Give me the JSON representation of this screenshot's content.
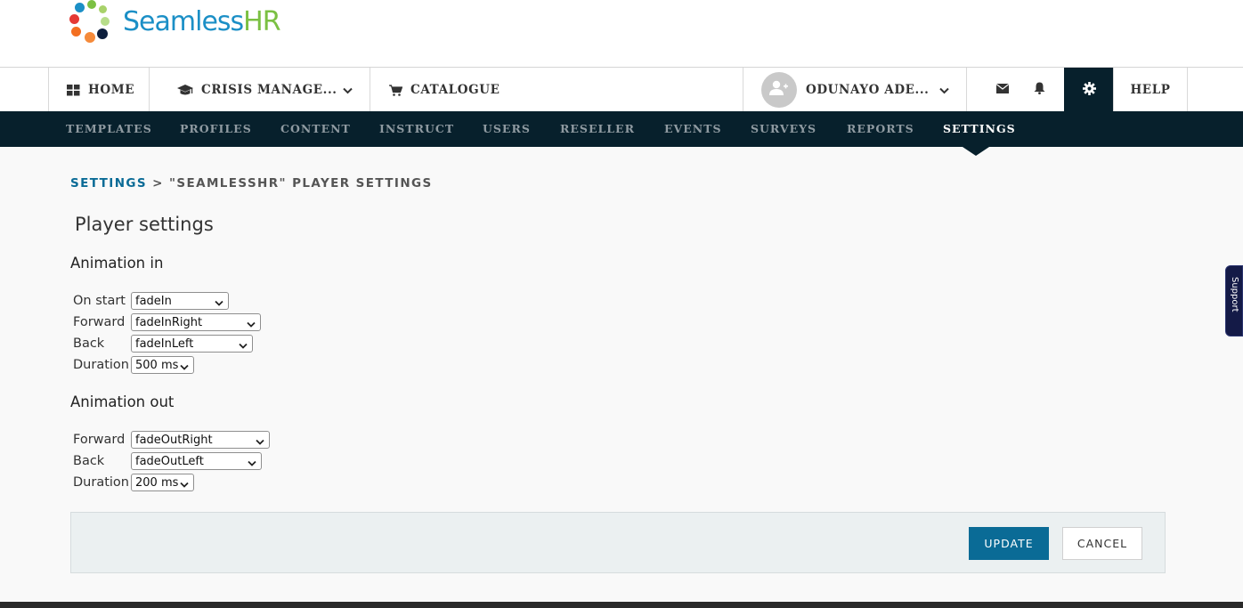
{
  "brand": {
    "name_part1": "Seamless",
    "name_part2": "HR",
    "color_primary": "#1b8fc6",
    "color_secondary": "#7bc043"
  },
  "topnav": {
    "home": {
      "label": "HOME",
      "icon": "grid-icon"
    },
    "crisis": {
      "label": "CRISIS MANAGE...",
      "icon": "graduation-cap-icon"
    },
    "catalogue": {
      "label": "CATALOGUE",
      "icon": "cart-icon"
    },
    "user": {
      "label": "ODUNAYO ADE...",
      "icon": "user-plus-icon"
    },
    "messages_icon": "envelope-icon",
    "notifications_icon": "bell-icon",
    "settings_icon": "gear-icon",
    "help": {
      "label": "HELP"
    }
  },
  "subnav": {
    "items": [
      {
        "label": "TEMPLATES"
      },
      {
        "label": "PROFILES"
      },
      {
        "label": "CONTENT"
      },
      {
        "label": "INSTRUCT"
      },
      {
        "label": "USERS"
      },
      {
        "label": "RESELLER"
      },
      {
        "label": "EVENTS"
      },
      {
        "label": "SURVEYS"
      },
      {
        "label": "REPORTS"
      },
      {
        "label": "SETTINGS"
      }
    ],
    "active": "SETTINGS"
  },
  "breadcrumb": {
    "link": "SETTINGS",
    "separator": ">",
    "current": "\"SEAMLESSHR\" PLAYER SETTINGS"
  },
  "page": {
    "title": "Player settings",
    "animation_in": {
      "heading": "Animation in",
      "fields": [
        {
          "label": "On start",
          "value": "fadeIn"
        },
        {
          "label": "Forward",
          "value": "fadeInRight"
        },
        {
          "label": "Back",
          "value": "fadeInLeft"
        },
        {
          "label": "Duration",
          "value": "500 ms"
        }
      ]
    },
    "animation_out": {
      "heading": "Animation out",
      "fields": [
        {
          "label": "Forward",
          "value": "fadeOutRight"
        },
        {
          "label": "Back",
          "value": "fadeOutLeft"
        },
        {
          "label": "Duration",
          "value": "200 ms"
        }
      ]
    }
  },
  "actions": {
    "update_label": "UPDATE",
    "cancel_label": "CANCEL",
    "update_color": "#0a6b96"
  },
  "support": {
    "label": "Support"
  },
  "colors": {
    "subnav_bg": "#07202c",
    "subnav_text": "#8f9aa1",
    "page_bg": "#f9f9f9"
  }
}
